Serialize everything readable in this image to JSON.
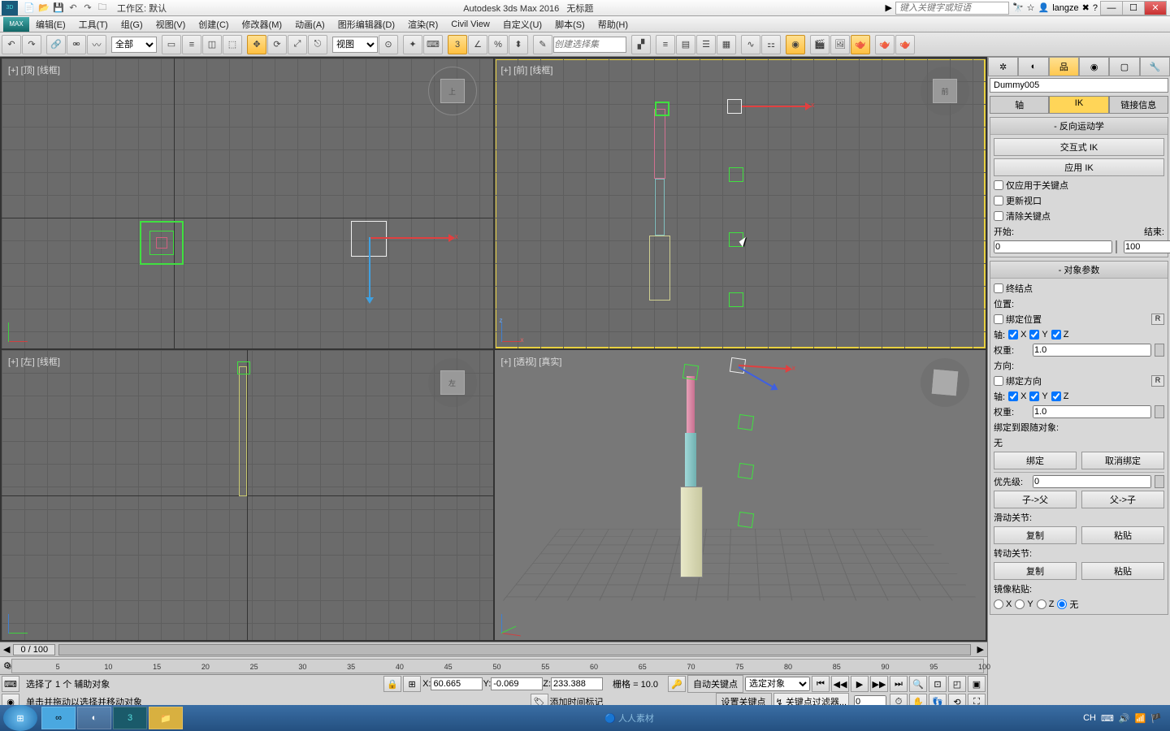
{
  "title": {
    "app": "Autodesk 3ds Max 2016",
    "doc": "无标题",
    "workspace": "工作区: 默认",
    "search_placeholder": "键入关键字或短语",
    "user": "langze"
  },
  "menu": [
    "编辑(E)",
    "工具(T)",
    "组(G)",
    "视图(V)",
    "创建(C)",
    "修改器(M)",
    "动画(A)",
    "图形编辑器(D)",
    "渲染(R)",
    "Civil View",
    "自定义(U)",
    "脚本(S)",
    "帮助(H)"
  ],
  "toolbar": {
    "filter": "全部",
    "refcoord": "视图",
    "selset_placeholder": "创建选择集"
  },
  "viewports": {
    "top": "[+] [顶] [线框]",
    "front": "[+] [前] [线框]",
    "left": "[+] [左] [线框]",
    "persp": "[+] [透视] [真实]"
  },
  "panel": {
    "objname": "Dummy005",
    "tab_pivot": "轴",
    "tab_ik": "IK",
    "tab_link": "链接信息",
    "roll_ik": "反向运动学",
    "btn_interactive": "交互式 IK",
    "btn_apply": "应用 IK",
    "chk_keyonly": "仅应用于关键点",
    "chk_updatevp": "更新视口",
    "chk_clearkey": "清除关键点",
    "lbl_start": "开始:",
    "lbl_end": "结束:",
    "val_start": "0",
    "val_end": "100",
    "roll_objparam": "对象参数",
    "chk_terminator": "终结点",
    "lbl_position": "位置:",
    "chk_bindpos": "绑定位置",
    "lbl_axis": "轴:",
    "chk_x": "X",
    "chk_y": "Y",
    "chk_z": "Z",
    "lbl_weight": "权重:",
    "val_weight": "1.0",
    "lbl_orient": "方向:",
    "chk_bindorient": "绑定方向",
    "lbl_bindfollow": "绑定到跟随对象:",
    "val_none": "无",
    "btn_bind": "绑定",
    "btn_unbind": "取消绑定",
    "lbl_precedence": "优先级:",
    "val_prec": "0",
    "btn_childparent": "子->父",
    "btn_parentchild": "父->子",
    "lbl_sliding": "滑动关节:",
    "btn_copy": "复制",
    "btn_paste": "粘贴",
    "lbl_rotational": "转动关节:",
    "lbl_mirror": "镜像粘贴:",
    "rad_none": "无"
  },
  "status": {
    "frame": "0 / 100",
    "prompt1": "选择了 1 个 辅助对象",
    "prompt2": "单击并拖动以选择并移动对象",
    "x": "60.665",
    "y": "-0.069",
    "z": "233.388",
    "grid": "栅格 = 10.0",
    "addtag": "添加时间标记",
    "autokey": "自动关键点",
    "setkey": "设置关键点",
    "selobj": "选定对象",
    "keyfilter": "关键点过滤器..."
  },
  "timeline_ticks": [
    0,
    5,
    10,
    15,
    20,
    25,
    30,
    35,
    40,
    45,
    50,
    55,
    60,
    65,
    70,
    75,
    80,
    85,
    90,
    95,
    100
  ],
  "tray": {
    "lang": "CH",
    "rrcg": "人人素材"
  }
}
